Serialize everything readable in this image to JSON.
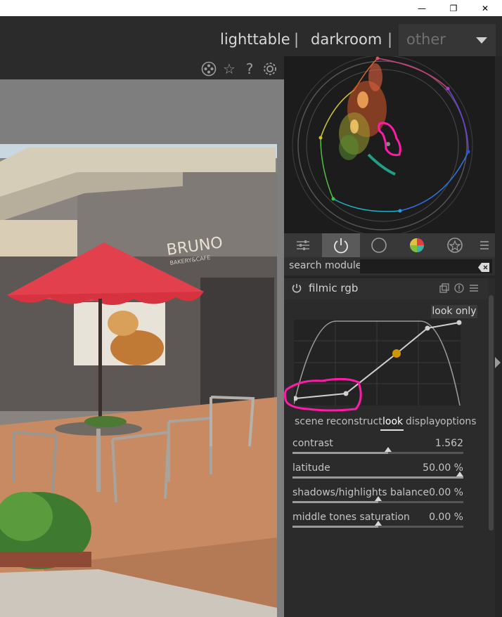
{
  "window": {
    "minimize": "—",
    "restore": "❐",
    "close": "✕"
  },
  "header": {
    "views": [
      "lighttable",
      "darkroom"
    ],
    "separator": "|",
    "other": "other"
  },
  "top_icons": [
    "film-roll-icon",
    "star-icon",
    "help-icon",
    "gear-icon"
  ],
  "help_glyph": "?",
  "star_glyph": "☆",
  "module_search": {
    "label": "search module",
    "value": ""
  },
  "module": {
    "title": "filmic rgb",
    "look_only": "look only",
    "subtabs": [
      "scene",
      "reconstruct",
      "look",
      "display",
      "options"
    ],
    "active_subtab": "look",
    "sliders": [
      {
        "label": "contrast",
        "value": "1.562",
        "fraction": 0.56
      },
      {
        "label": "latitude",
        "value": "50.00 %",
        "fraction": 1.0
      },
      {
        "label": "shadows/highlights balance",
        "value": "0.00 %",
        "fraction": 0.5
      },
      {
        "label": "middle tones saturation",
        "value": "0.00 %",
        "fraction": 0.5
      }
    ]
  },
  "accent": "#ff1aa8",
  "photo_sign": {
    "brand": "BRUNO",
    "sub": "BAKERY&CAFE"
  }
}
